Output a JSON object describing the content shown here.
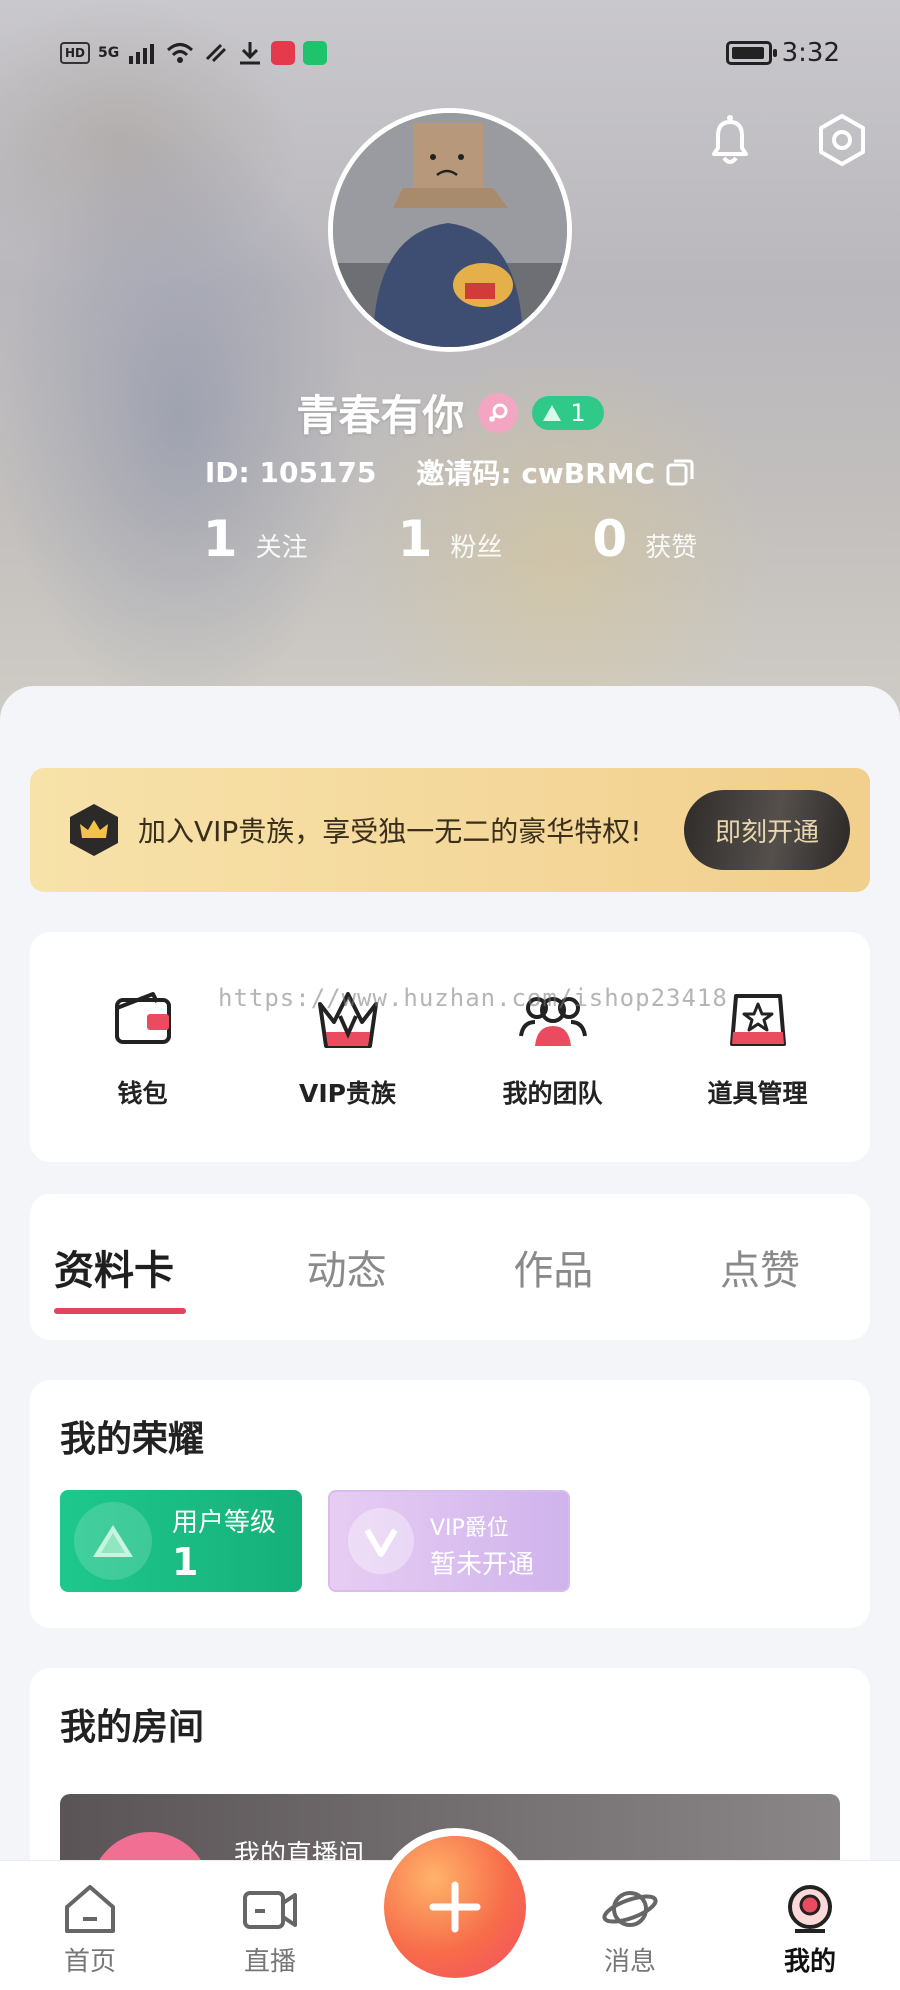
{
  "status_bar": {
    "network": "5G",
    "hd": "HD",
    "time": "3:32"
  },
  "profile": {
    "name": "青春有你",
    "level": "1",
    "id_text": "ID: 105175",
    "invite_text": "邀请码: cwBRMC",
    "stats": [
      {
        "num": "1",
        "label": "关注"
      },
      {
        "num": "1",
        "label": "粉丝"
      },
      {
        "num": "0",
        "label": "获赞"
      }
    ]
  },
  "vip_banner": {
    "text": "加入VIP贵族，享受独一无二的豪华特权!",
    "button": "即刻开通"
  },
  "quick_actions": [
    {
      "label": "钱包",
      "icon": "wallet-icon"
    },
    {
      "label": "VIP贵族",
      "icon": "crown-icon"
    },
    {
      "label": "我的团队",
      "icon": "team-icon"
    },
    {
      "label": "道具管理",
      "icon": "props-icon"
    }
  ],
  "watermark": "https://www.huzhan.com/ishop23418",
  "tabs": [
    "资料卡",
    "动态",
    "作品",
    "点赞"
  ],
  "honor": {
    "title": "我的荣耀",
    "user_level_label": "用户等级",
    "user_level_value": "1",
    "vip_label": "VIP爵位",
    "vip_value": "暂未开通"
  },
  "room": {
    "title": "我的房间",
    "live_room_name": "我的直播间"
  },
  "bottom_nav": [
    {
      "label": "首页",
      "icon": "home-icon"
    },
    {
      "label": "直播",
      "icon": "video-camera-icon"
    },
    {
      "label": "消息",
      "icon": "planet-icon"
    },
    {
      "label": "我的",
      "icon": "profile-icon"
    }
  ],
  "colors": {
    "accent": "#e0445f",
    "level_green": "#1ec88c",
    "vip_gold": "#f4d79a"
  }
}
